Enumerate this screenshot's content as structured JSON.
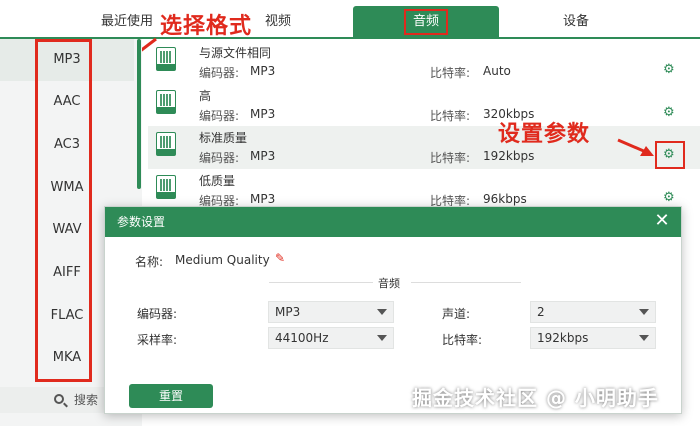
{
  "tabs": {
    "recent": "最近使用",
    "video": "视频",
    "audio": "音频",
    "device": "设备"
  },
  "annotations": {
    "format": "选择格式",
    "params": "设置参数"
  },
  "sidebar": {
    "items": [
      {
        "label": "MP3"
      },
      {
        "label": "AAC"
      },
      {
        "label": "AC3"
      },
      {
        "label": "WMA"
      },
      {
        "label": "WAV"
      },
      {
        "label": "AIFF"
      },
      {
        "label": "FLAC"
      },
      {
        "label": "MKA"
      }
    ],
    "search": "搜索",
    "selected": "MP3"
  },
  "presets": [
    {
      "name": "与源文件相同",
      "encoder_label": "编码器:",
      "encoder": "MP3",
      "bitrate_label": "比特率:",
      "bitrate": "Auto"
    },
    {
      "name": "高",
      "encoder_label": "编码器:",
      "encoder": "MP3",
      "bitrate_label": "比特率:",
      "bitrate": "320kbps"
    },
    {
      "name": "标准质量",
      "encoder_label": "编码器:",
      "encoder": "MP3",
      "bitrate_label": "比特率:",
      "bitrate": "192kbps"
    },
    {
      "name": "低质量",
      "encoder_label": "编码器:",
      "encoder": "MP3",
      "bitrate_label": "比特率:",
      "bitrate": "96kbps"
    }
  ],
  "modal": {
    "title": "参数设置",
    "name_label": "名称:",
    "name_value": "Medium Quality",
    "section": "音频",
    "encoder_label": "编码器:",
    "encoder_value": "MP3",
    "channel_label": "声道:",
    "channel_value": "2",
    "samplerate_label": "采样率:",
    "samplerate_value": "44100Hz",
    "bitrate_label": "比特率:",
    "bitrate_value": "192kbps",
    "reset_label": "重置"
  },
  "watermark": "掘金技术社区 @ 小明助手",
  "colors": {
    "accent": "#2e8b57",
    "annotation": "#e02a1d"
  }
}
